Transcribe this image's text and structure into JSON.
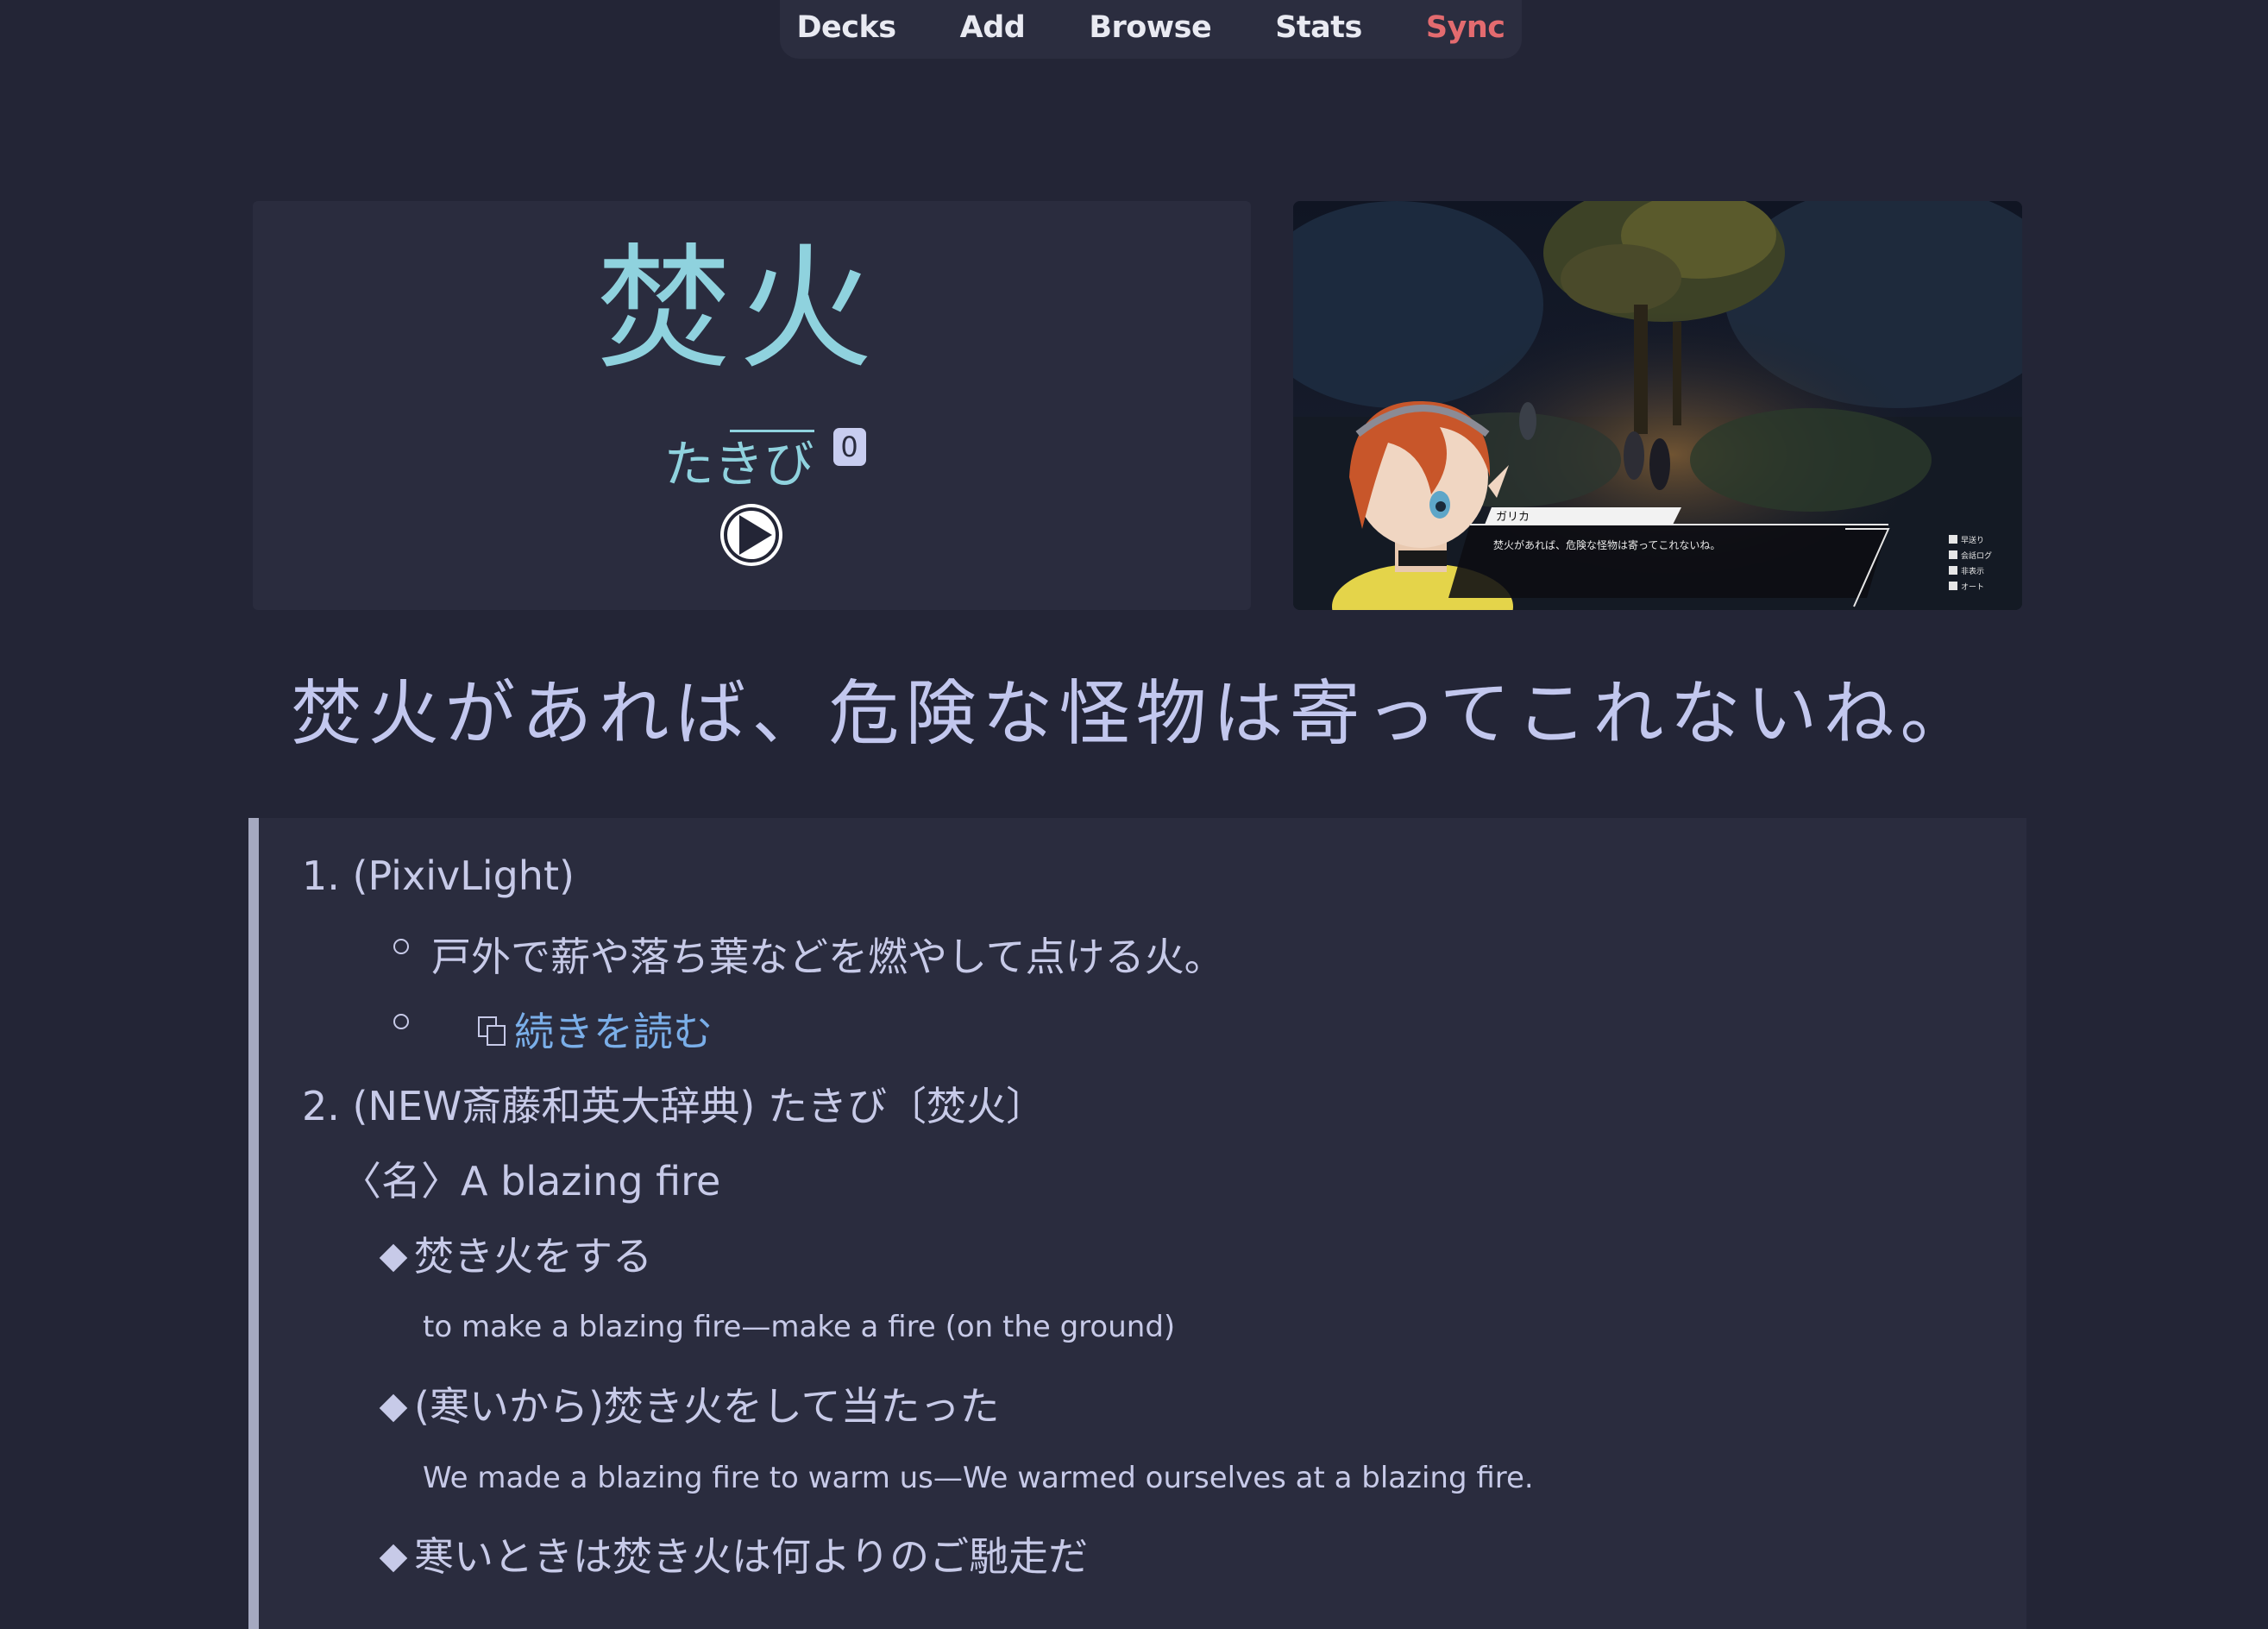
{
  "nav": {
    "decks": "Decks",
    "add": "Add",
    "browse": "Browse",
    "stats": "Stats",
    "sync": "Sync"
  },
  "card": {
    "kanji": "焚火",
    "reading": "たきび",
    "pitch_accent": "0",
    "play_icon": "play-circle-icon"
  },
  "screenshot": {
    "speaker": "ガリカ",
    "dialogue": "焚火があれば、危険な怪物は寄ってこれないね。",
    "buttons": [
      "早送り",
      "会話ログ",
      "非表示",
      "オート"
    ]
  },
  "sentence": "焚火があれば、危険な怪物は寄ってこれないね。",
  "definitions": {
    "entry1_header": "1. (PixivLight)",
    "entry1_text": "戸外で薪や落ち葉などを燃やして点ける火。",
    "entry1_link": "続きを読む",
    "entry2_header": "2. (NEW斎藤和英大辞典) たきび〔焚火〕",
    "entry2_pos": "〈名〉A blazing fire",
    "ex1_jp": "焚き火をする",
    "ex1_en": "to make a blazing fire—make a fire (on the ground)",
    "ex2_jp": "(寒いから)焚き火をして当たった",
    "ex2_en": "We made a blazing fire to warm us—We warmed ourselves at a blazing fire.",
    "ex3_jp": "寒いときは焚き火は何よりのご馳走だ"
  },
  "colors": {
    "background": "#232536",
    "panel": "#2a2c3e",
    "accent_kanji": "#8fd2de",
    "sync": "#e36b6f",
    "link": "#7aaee8"
  }
}
